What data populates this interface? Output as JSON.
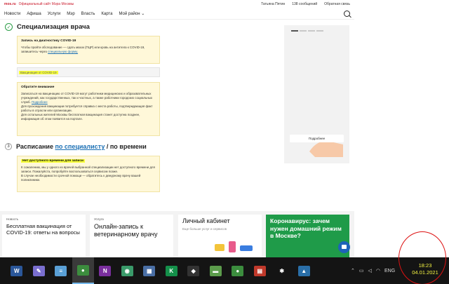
{
  "topbar": {
    "logo": "mos.ru",
    "site_title": "Официальный сайт Мэра Москвы",
    "user_name": "Татьяна Пятин",
    "messages": "138 сообщений",
    "feedback": "Обратная связь"
  },
  "nav": [
    "Новости",
    "Афиша",
    "Услуги",
    "Мэр",
    "Власть",
    "Карта",
    "Мой район ⌄"
  ],
  "step1": {
    "check": "✓",
    "title": "Специализация врача"
  },
  "card_diag": {
    "title": "Запись на диагностику COVID-19",
    "text": "Чтобы пройти обследование — сдать мазок (ПЦР) или кровь на антитела к COVID-19, запишитесь через",
    "link": "специальную форму."
  },
  "grey_select": "Вакцинация от COVID-19",
  "card_attention": {
    "title": "Обратите внимание",
    "p1": "Записаться на вакцинацию от COVID-19 могут работники медицинских и образовательных учреждений, как государственных, так и частных, а также работники городских социальных служб.",
    "p1_link": "Подробнее",
    "p2": "Для прохождения вакцинации потребуется справка с места работы, подтверждающая факт работы в отрасли или организации.",
    "p3": "Для остальных жителей Москвы бесплатная вакцинация станет доступна позднее, информация об этом появится на портале."
  },
  "step3": {
    "num": "3",
    "prefix": "Расписание",
    "link": "по специалисту",
    "suffix": "/ по времени"
  },
  "card_none": {
    "title": "Нет доступного времени для записи",
    "p1": "К сожалению, мы у одного из врачей выбранной специализации нет доступного времени для записи. Пожалуйста, попробуйте воспользоваться сервисом позже.",
    "p2": "В случае необходимости срочной помощи — обратитесь к дежурному врачу вашей поликлиники."
  },
  "banner": {
    "button": "Подробнее"
  },
  "tiles": [
    {
      "cat": "Новость",
      "title": "Бесплатная вакцинация от COVID-19: ответы на вопросы"
    },
    {
      "cat": "Услуга",
      "title": "Онлайн-запись к ветеринарному врачу"
    },
    {
      "title": "Личный кабинет",
      "sub": "Еще больше услуг и сервисов"
    },
    {
      "title": "Коронавирус: зачем нужен домашний режим в Москве?"
    }
  ],
  "taskbar": {
    "apps": [
      {
        "name": "word-icon",
        "glyph": "W",
        "color": "#2b579a"
      },
      {
        "name": "paint-icon",
        "glyph": "✎",
        "color": "#7a6fd0"
      },
      {
        "name": "notepad-icon",
        "glyph": "≡",
        "color": "#5aa0d6"
      },
      {
        "name": "chrome-icon",
        "glyph": "●",
        "color": "#3c8d3e"
      },
      {
        "name": "onenote-icon",
        "glyph": "N",
        "color": "#7a2f9e"
      },
      {
        "name": "globe-icon",
        "glyph": "◉",
        "color": "#3a9b6a"
      },
      {
        "name": "calculator-icon",
        "glyph": "▦",
        "color": "#4a6fa5"
      },
      {
        "name": "k-app-icon",
        "glyph": "K",
        "color": "#14904a"
      },
      {
        "name": "settings-app-icon",
        "glyph": "◆",
        "color": "#333"
      },
      {
        "name": "money-icon",
        "glyph": "▬",
        "color": "#5c9c4c"
      },
      {
        "name": "chrome-2-icon",
        "glyph": "●",
        "color": "#3c8d3e"
      },
      {
        "name": "keyboard-icon",
        "glyph": "▤",
        "color": "#c0392b"
      },
      {
        "name": "gear-icon",
        "glyph": "✱",
        "color": "#141414"
      },
      {
        "name": "photos-icon",
        "glyph": "▲",
        "color": "#2a6fa8"
      }
    ],
    "tray_up": "⌃",
    "tray_lang": "ENG",
    "time": "18:23",
    "date": "04.01.2021"
  }
}
